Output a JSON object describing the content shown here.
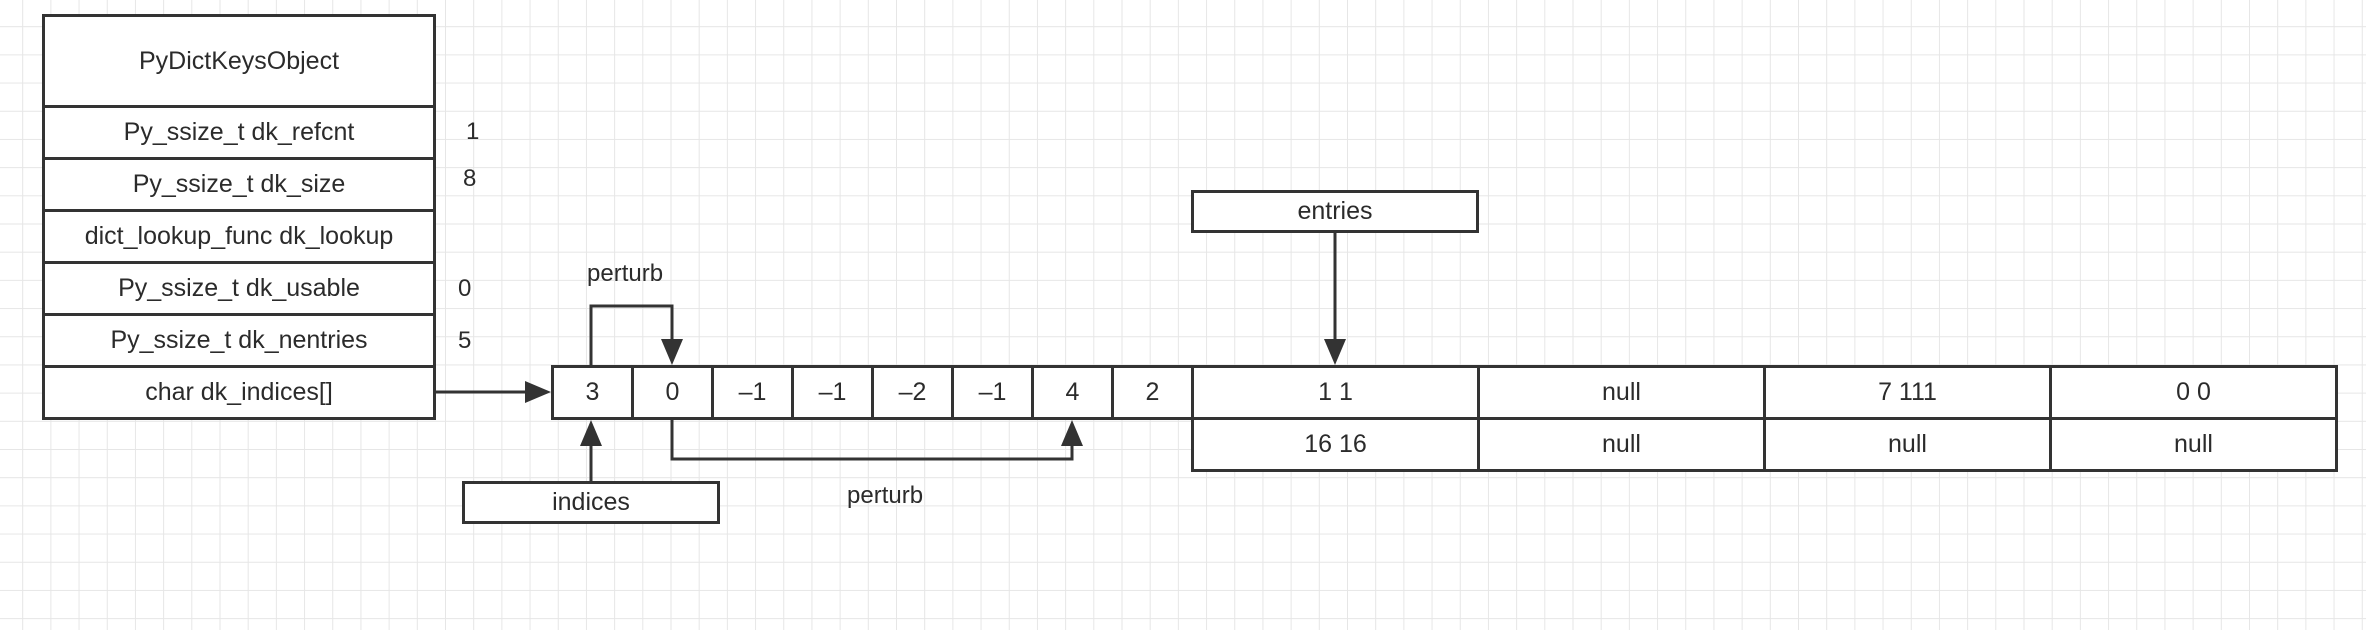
{
  "struct": {
    "title": "PyDictKeysObject",
    "fields": [
      {
        "label": "Py_ssize_t dk_refcnt",
        "value": "1"
      },
      {
        "label": "Py_ssize_t dk_size",
        "value": "8"
      },
      {
        "label": "dict_lookup_func dk_lookup",
        "value": ""
      },
      {
        "label": "Py_ssize_t dk_usable",
        "value": "0"
      },
      {
        "label": "Py_ssize_t dk_nentries",
        "value": "5"
      },
      {
        "label": "char dk_indices[]",
        "value": ""
      }
    ]
  },
  "indices": {
    "label": "indices",
    "cells": [
      "3",
      "0",
      "–1",
      "–1",
      "–2",
      "–1",
      "4",
      "2"
    ]
  },
  "entries": {
    "label": "entries",
    "top_row": [
      "1 1",
      "null",
      "7 111",
      "0 0"
    ],
    "bottom_row": [
      "16 16",
      "null",
      "null",
      "null"
    ]
  },
  "perturb_labels": [
    "perturb",
    "perturb"
  ]
}
